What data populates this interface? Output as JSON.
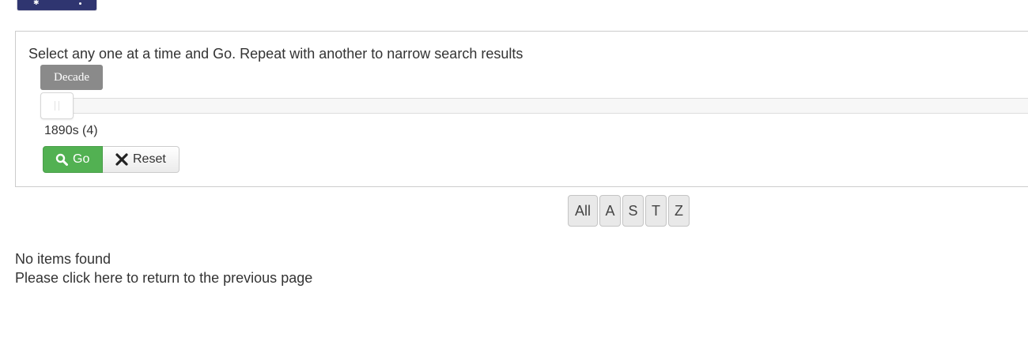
{
  "filter": {
    "instructions": "Select any one at a time and Go. Repeat with another to narrow search results",
    "decade_label": "Decade",
    "decade_value": "1890s (4)",
    "slider_position": 0,
    "go_label": "Go",
    "reset_label": "Reset",
    "go_color": "#52b152"
  },
  "alphabet": [
    "All",
    "A",
    "S",
    "T",
    "Z"
  ],
  "results": {
    "no_items": "No items found",
    "return_prefix": "Please click ",
    "return_link": "here",
    "return_suffix": " to return to the previous page"
  },
  "icons": {
    "go": "search-icon",
    "reset": "close-icon"
  }
}
